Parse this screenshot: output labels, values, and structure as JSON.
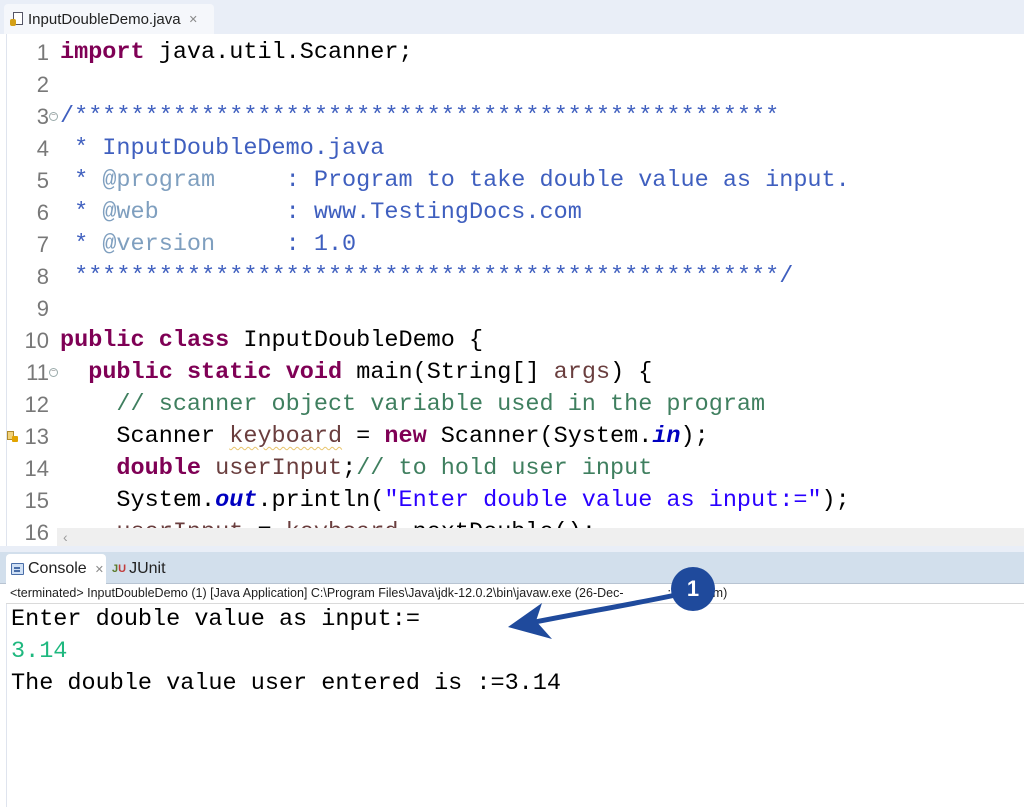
{
  "editor": {
    "tab": {
      "title": "InputDoubleDemo.java",
      "icon": "java-file-icon",
      "close_icon": "close-icon"
    },
    "lines": [
      {
        "n": "1",
        "tokens": [
          {
            "t": "import",
            "c": "kw"
          },
          {
            "t": " java.util.Scanner;",
            "c": ""
          }
        ]
      },
      {
        "n": "2",
        "tokens": []
      },
      {
        "n": "3",
        "fold": true,
        "tokens": [
          {
            "t": "/**************************************************",
            "c": "jdoc"
          }
        ]
      },
      {
        "n": "4",
        "tokens": [
          {
            "t": " * InputDoubleDemo.java",
            "c": "jdoc"
          }
        ]
      },
      {
        "n": "5",
        "tokens": [
          {
            "t": " * ",
            "c": "jdoc"
          },
          {
            "t": "@program",
            "c": "jdoc jtag"
          },
          {
            "t": "     : Program to take double value as input.",
            "c": "jdoc"
          }
        ]
      },
      {
        "n": "6",
        "tokens": [
          {
            "t": " * ",
            "c": "jdoc"
          },
          {
            "t": "@web",
            "c": "jdoc jtag"
          },
          {
            "t": "         : www.TestingDocs.com",
            "c": "jdoc"
          }
        ]
      },
      {
        "n": "7",
        "tokens": [
          {
            "t": " * ",
            "c": "jdoc"
          },
          {
            "t": "@version",
            "c": "jdoc jtag"
          },
          {
            "t": "     : 1.0",
            "c": "jdoc"
          }
        ]
      },
      {
        "n": "8",
        "tokens": [
          {
            "t": " **************************************************/",
            "c": "jdoc"
          }
        ]
      },
      {
        "n": "9",
        "tokens": []
      },
      {
        "n": "10",
        "tokens": [
          {
            "t": "public",
            "c": "kw"
          },
          {
            "t": " ",
            "c": ""
          },
          {
            "t": "class",
            "c": "kw"
          },
          {
            "t": " InputDoubleDemo {",
            "c": ""
          }
        ]
      },
      {
        "n": "11",
        "fold": true,
        "tokens": [
          {
            "t": "  ",
            "c": ""
          },
          {
            "t": "public",
            "c": "kw"
          },
          {
            "t": " ",
            "c": ""
          },
          {
            "t": "static",
            "c": "kw"
          },
          {
            "t": " ",
            "c": ""
          },
          {
            "t": "void",
            "c": "kw"
          },
          {
            "t": " main(String[] ",
            "c": ""
          },
          {
            "t": "args",
            "c": "var"
          },
          {
            "t": ") {",
            "c": ""
          }
        ]
      },
      {
        "n": "12",
        "tokens": [
          {
            "t": "    ",
            "c": ""
          },
          {
            "t": "// scanner object variable used in the program",
            "c": "cm"
          }
        ]
      },
      {
        "n": "13",
        "warning": true,
        "tokens": [
          {
            "t": "    Scanner ",
            "c": ""
          },
          {
            "t": "keyboard",
            "c": "var squiggle"
          },
          {
            "t": " = ",
            "c": ""
          },
          {
            "t": "new",
            "c": "kw"
          },
          {
            "t": " Scanner(System.",
            "c": ""
          },
          {
            "t": "in",
            "c": "fld"
          },
          {
            "t": ");",
            "c": ""
          }
        ]
      },
      {
        "n": "14",
        "tokens": [
          {
            "t": "    ",
            "c": ""
          },
          {
            "t": "double",
            "c": "kw"
          },
          {
            "t": " ",
            "c": ""
          },
          {
            "t": "userInput",
            "c": "var"
          },
          {
            "t": ";",
            "c": ""
          },
          {
            "t": "// to hold user input",
            "c": "cm"
          }
        ]
      },
      {
        "n": "15",
        "tokens": [
          {
            "t": "    System.",
            "c": ""
          },
          {
            "t": "out",
            "c": "fld"
          },
          {
            "t": ".println(",
            "c": ""
          },
          {
            "t": "\"Enter double value as input:=\"",
            "c": "str"
          },
          {
            "t": ");",
            "c": ""
          }
        ]
      },
      {
        "n": "16",
        "tokens": [
          {
            "t": "    ",
            "c": ""
          },
          {
            "t": "userInput",
            "c": "var"
          },
          {
            "t": " = ",
            "c": ""
          },
          {
            "t": "keyboard",
            "c": "var"
          },
          {
            "t": ".nextDouble();",
            "c": ""
          }
        ]
      }
    ],
    "scroll_left_icon": "‹"
  },
  "console": {
    "tabs": [
      {
        "label": "Console",
        "icon": "console-icon",
        "active": true
      },
      {
        "label": "JUnit",
        "icon": "junit-icon",
        "active": false
      }
    ],
    "status": "<terminated> InputDoubleDemo (1) [Java Application] C:\\Program Files\\Java\\jdk-12.0.2\\bin\\javaw.exe (26-Dec-2019 7:47:48 pm)",
    "status_visible": "<terminated> InputDoubleDemo (1) [Java Application] C:\\Program Files\\Java\\jdk-12.0.2\\bin\\javaw.exe (26-Dec-",
    "status_tail": ":47:48 pm)",
    "output": [
      {
        "text": "Enter double value as input:=",
        "kind": "stdout"
      },
      {
        "text": "3.14",
        "kind": "stdin"
      },
      {
        "text": "The double value user entered is :=3.14",
        "kind": "stdout"
      }
    ]
  },
  "annotation": {
    "badge": "1",
    "color": "#1f4a9c"
  },
  "colors": {
    "keyword": "#7f0055",
    "javadoc": "#3f5fbf",
    "comment": "#3f7f5f",
    "string": "#2a00ff",
    "console_input": "#1fb87f"
  }
}
